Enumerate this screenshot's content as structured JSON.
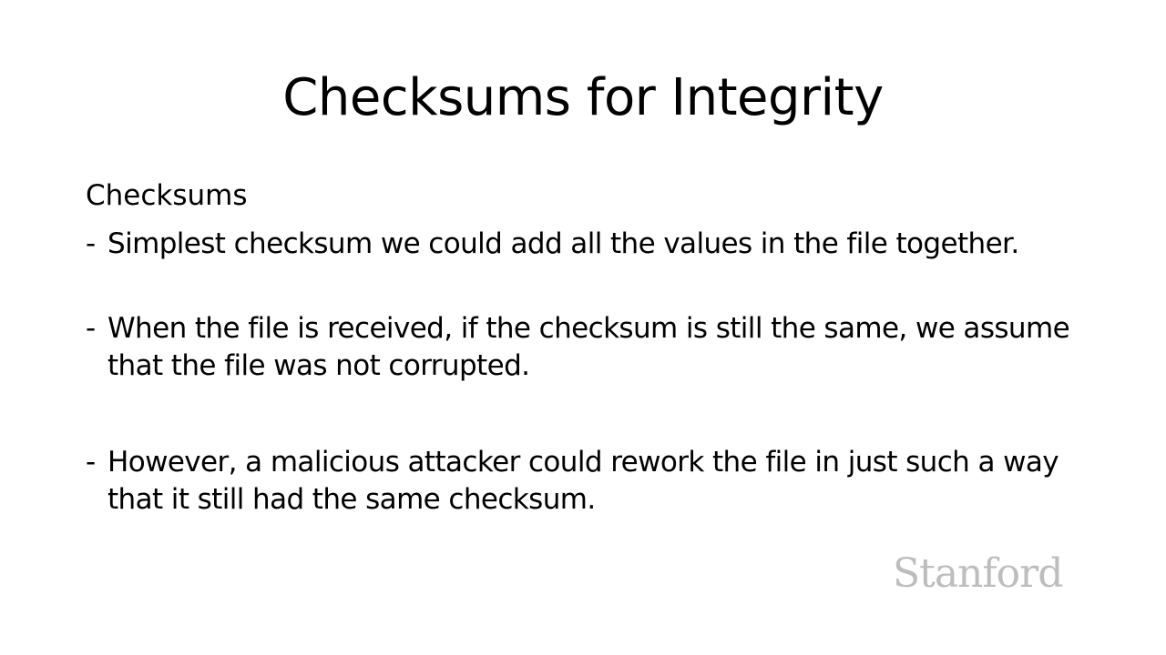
{
  "slide": {
    "title": "Checksums for Integrity",
    "heading": "Checksums",
    "bullets": [
      {
        "marker": "-",
        "text": "Simplest checksum we could add all the values in the file together."
      },
      {
        "marker": "-",
        "text": "When the file is received, if the checksum is still the same, we assume that the file was not corrupted."
      },
      {
        "marker": "-",
        "text": "However, a malicious attacker could rework the file in just such a way that it still had the same checksum."
      }
    ],
    "logo": "Stanford"
  },
  "colors": {
    "background": "#ffffff",
    "text": "#000000",
    "logo": "#bdbdbd"
  }
}
